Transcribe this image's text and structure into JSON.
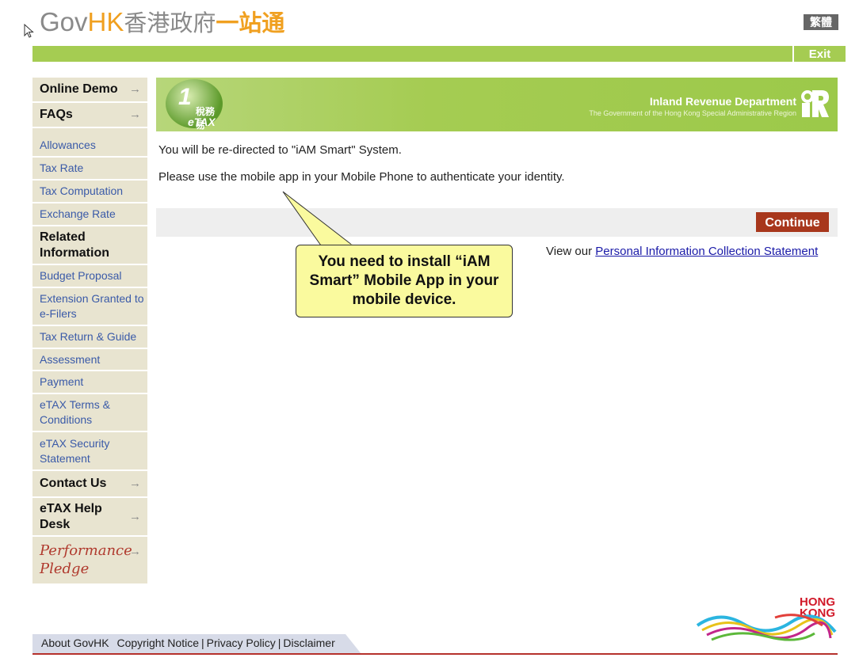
{
  "header": {
    "logo_gov": "Gov",
    "logo_hk": "HK",
    "logo_zh1": "香港政府",
    "logo_zh2": "一站通",
    "lang_button": "繁體",
    "exit_button": "Exit"
  },
  "sidebar": {
    "items": [
      {
        "label": "Online Demo",
        "type": "bold",
        "arrow": true
      },
      {
        "label": "FAQs",
        "type": "bold",
        "arrow": true
      },
      {
        "label": "Allowances",
        "type": "link"
      },
      {
        "label": "Tax Rate",
        "type": "link"
      },
      {
        "label": "Tax Computation",
        "type": "link"
      },
      {
        "label": "Exchange Rate",
        "type": "link"
      },
      {
        "label": "Related Information",
        "type": "heading"
      },
      {
        "label": "Budget Proposal",
        "type": "link"
      },
      {
        "label": "Extension Granted to e-Filers",
        "type": "link"
      },
      {
        "label": "Tax Return & Guide",
        "type": "link"
      },
      {
        "label": "Assessment",
        "type": "link"
      },
      {
        "label": "Payment",
        "type": "link"
      },
      {
        "label": "eTAX Terms & Conditions",
        "type": "link"
      },
      {
        "label": "eTAX Security Statement",
        "type": "link"
      },
      {
        "label": "Contact Us",
        "type": "bold",
        "arrow": true
      },
      {
        "label": "eTAX Help Desk",
        "type": "bold",
        "arrow": true
      }
    ],
    "performance_pledge_line1": "Performance",
    "performance_pledge_line2": "Pledge"
  },
  "banner": {
    "etax_zh": "稅務易",
    "etax_en": "eTAX",
    "dept_name": "Inland Revenue Department",
    "dept_sub": "The Government of the Hong Kong Special Administrative Region"
  },
  "main": {
    "message1": "You will be re-directed to \"iAM Smart\" System.",
    "message2": "Please use the mobile app in your Mobile Phone to authenticate your identity.",
    "continue_button": "Continue",
    "pics_prefix": "View our ",
    "pics_link": "Personal Information Collection Statement"
  },
  "callout": {
    "text": "You need to install “iAM Smart” Mobile App in your mobile device."
  },
  "footer": {
    "links": [
      "About GovHK",
      "Copyright Notice",
      "Privacy Policy",
      "Disclaimer"
    ],
    "brand_line1": "HONG",
    "brand_line2": "KONG"
  },
  "colors": {
    "green": "#a5cc52",
    "continue": "#a8371c",
    "sidebar_bg": "#e8e4d0",
    "link": "#3a5aa8",
    "footer_rule": "#b5312c",
    "callout_bg": "#fafa9e"
  }
}
